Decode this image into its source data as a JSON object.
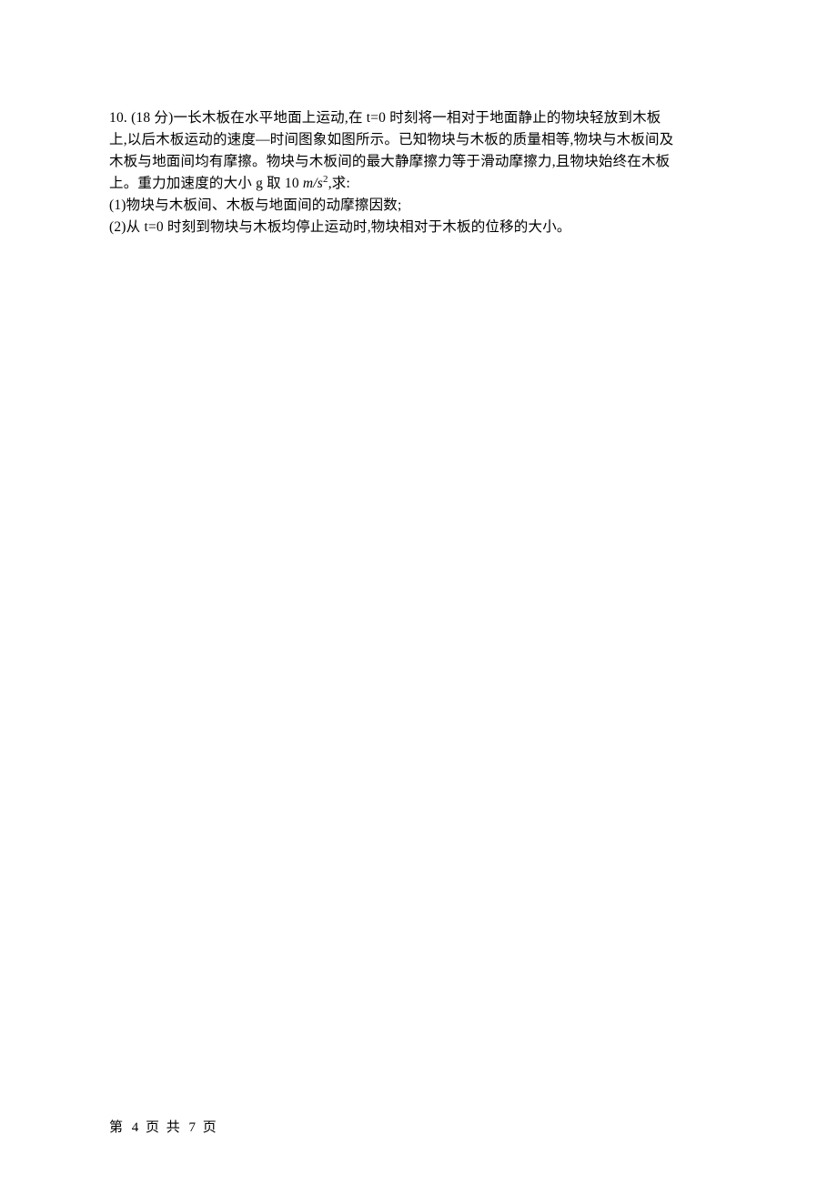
{
  "question": {
    "number": "10.",
    "points_label": "(18 分)",
    "line1_rest": "一长木板在水平地面上运动,在 t=0 时刻将一相对于地面静止的物块轻放到木板",
    "line2": "上,以后木板运动的速度—时间图象如图所示。已知物块与木板的质量相等,物块与木板间及",
    "line3": "木板与地面间均有摩擦。物块与木板间的最大静摩擦力等于滑动摩擦力,且物块始终在木板",
    "line4_prefix": "上。重力加速度的大小 g 取 10 ",
    "unit_m": "m",
    "unit_slash": "/",
    "unit_s": "s",
    "unit_exp": "2",
    "line4_suffix": ",求:",
    "sub1": "(1)物块与木板间、木板与地面间的动摩擦因数;",
    "sub2": "(2)从 t=0 时刻到物块与木板均停止运动时,物块相对于木板的位移的大小。"
  },
  "footer": {
    "prefix": "第",
    "page_current": "4",
    "mid": "页 共",
    "page_total": "7",
    "suffix": "页"
  }
}
